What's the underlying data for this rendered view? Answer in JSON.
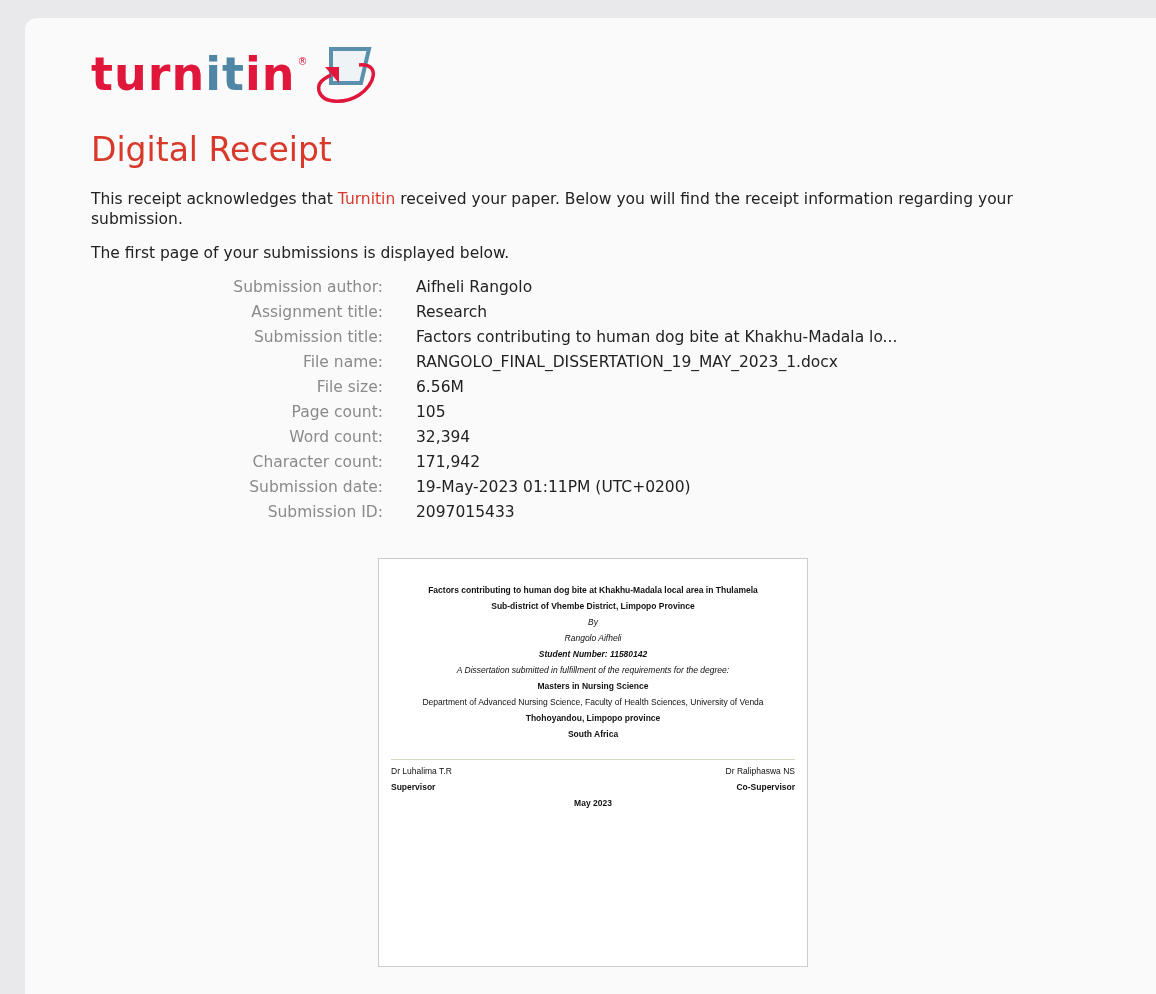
{
  "logo": {
    "parts": [
      {
        "text": "turn",
        "color": "#e0163b"
      },
      {
        "text": "it",
        "color": "#4f86a6"
      },
      {
        "text": "in",
        "color": "#e0163b"
      }
    ],
    "mark": "®"
  },
  "title": "Digital Receipt",
  "intro": [
    {
      "text": "This receipt acknowledges that ",
      "kind": "plain"
    },
    {
      "text": "Turnitin",
      "kind": "highlight"
    },
    {
      "text": " received your paper. Below you will find the receipt information regarding your submission.",
      "kind": "plain"
    }
  ],
  "note": "The first page of your submissions is displayed below.",
  "details": [
    {
      "label": "Submission author:",
      "value": "Aifheli Rangolo"
    },
    {
      "label": "Assignment title:",
      "value": "Research"
    },
    {
      "label": "Submission title:",
      "value": "Factors contributing to human dog bite at Khakhu-Madala lo..."
    },
    {
      "label": "File name:",
      "value": "RANGOLO_FINAL_DISSERTATION_19_MAY_2023_1.docx"
    },
    {
      "label": "File size:",
      "value": "6.56M"
    },
    {
      "label": "Page count:",
      "value": "105"
    },
    {
      "label": "Word count:",
      "value": "32,394"
    },
    {
      "label": "Character count:",
      "value": "171,942"
    },
    {
      "label": "Submission date:",
      "value": "19-May-2023 01:11PM (UTC+0200)"
    },
    {
      "label": "Submission ID:",
      "value": "2097015433"
    }
  ],
  "document": {
    "lines": [
      {
        "text": "Factors contributing to human dog bite at Khakhu-Madala local area in Thulamela",
        "kind": "bold"
      },
      {
        "text": "Sub-district of Vhembe District, Limpopo Province",
        "kind": "bold"
      },
      {
        "text": "By",
        "kind": "italic"
      },
      {
        "text": "Rangolo Aifheli",
        "kind": "italic"
      },
      {
        "text": "Student Number: 11580142",
        "kind": "bolditalic"
      },
      {
        "text": "A Dissertation submitted in fulfillment of the requirements for the degree:",
        "kind": "italic"
      },
      {
        "text": "Masters in Nursing Science",
        "kind": "bold"
      },
      {
        "text": "Department of Advanced Nursing Science, Faculty of Health Sciences, University of Venda",
        "kind": "plain"
      },
      {
        "text": "Thohoyandou, Limpopo province",
        "kind": "bold"
      },
      {
        "text": "South Africa",
        "kind": "bold"
      }
    ],
    "signatures": [
      {
        "name": "Dr Luhalima T.R",
        "role": "Supervisor"
      },
      {
        "name": "Dr Raliphaswa NS",
        "role": "Co-Supervisor"
      }
    ],
    "date": "May 2023"
  }
}
